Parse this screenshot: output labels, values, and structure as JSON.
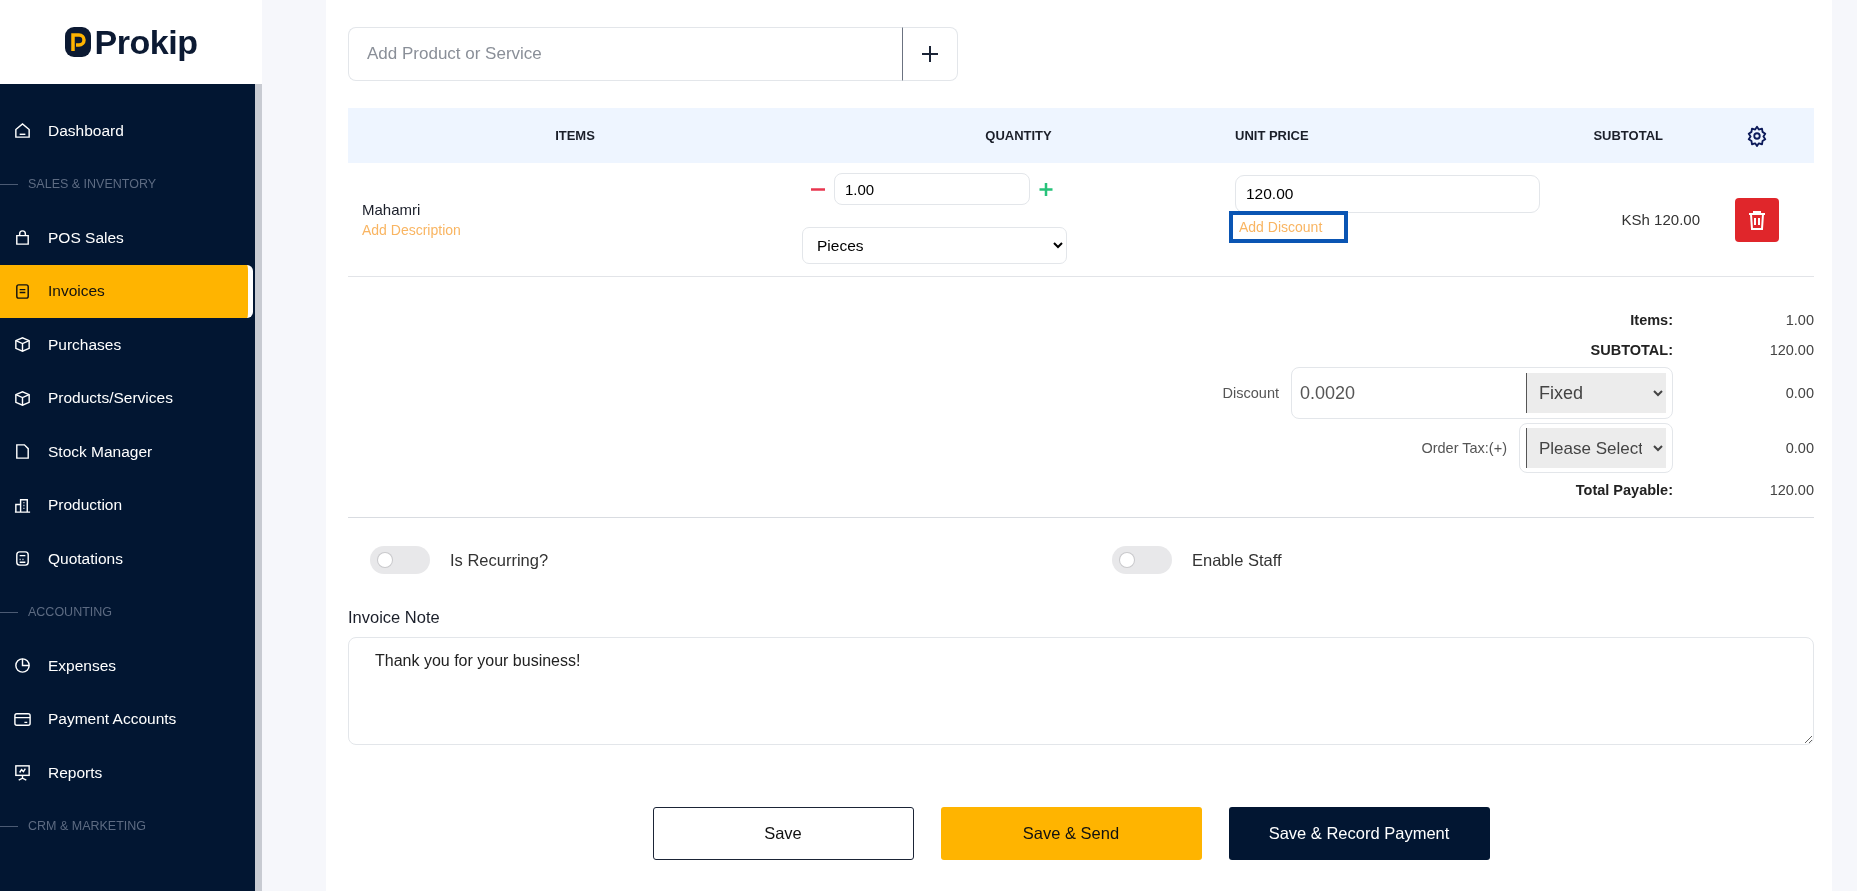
{
  "logo": {
    "text": "Prokip"
  },
  "sidebar": {
    "items": [
      {
        "kind": "link",
        "label": "Dashboard",
        "selected": false
      },
      {
        "kind": "section",
        "label": "SALES & INVENTORY"
      },
      {
        "kind": "link",
        "label": "POS Sales",
        "selected": false
      },
      {
        "kind": "link",
        "label": "Invoices",
        "selected": true
      },
      {
        "kind": "link",
        "label": "Purchases",
        "selected": false
      },
      {
        "kind": "link",
        "label": "Products/Services",
        "selected": false
      },
      {
        "kind": "link",
        "label": "Stock Manager",
        "selected": false
      },
      {
        "kind": "link",
        "label": "Production",
        "selected": false
      },
      {
        "kind": "link",
        "label": "Quotations",
        "selected": false
      },
      {
        "kind": "section",
        "label": "ACCOUNTING"
      },
      {
        "kind": "link",
        "label": "Expenses",
        "selected": false
      },
      {
        "kind": "link",
        "label": "Payment Accounts",
        "selected": false
      },
      {
        "kind": "link",
        "label": "Reports",
        "selected": false
      },
      {
        "kind": "section",
        "label": "CRM & MARKETING"
      }
    ]
  },
  "product_search": {
    "placeholder": "Add Product or Service"
  },
  "table": {
    "columns": [
      "ITEMS",
      "QUANTITY",
      "UNIT PRICE",
      "SUBTOTAL"
    ],
    "rows": [
      {
        "item": "Mahamri",
        "description_link": "Add Description",
        "quantity": "1.00",
        "unit": "Pieces",
        "unit_price": "120.00",
        "discount_link": "Add Discount",
        "discount_link_highlighted": true,
        "subtotal": "KSh 120.00"
      }
    ]
  },
  "totals": [
    {
      "kind": "plain",
      "label": "Items:",
      "value": "1.00"
    },
    {
      "kind": "plain",
      "label": "SUBTOTAL:",
      "value": "120.00"
    },
    {
      "kind": "discount",
      "label": "Discount",
      "amount": "0.0020",
      "type": "Fixed",
      "value": "0.00"
    },
    {
      "kind": "tax",
      "label": "Order Tax:(+)",
      "select": "Please Select",
      "value": "0.00"
    },
    {
      "kind": "plain",
      "label": "Total Payable:",
      "value": "120.00"
    }
  ],
  "toggles": [
    {
      "label": "Is Recurring?",
      "on": false
    },
    {
      "label": "Enable Staff",
      "on": false
    }
  ],
  "note": {
    "label": "Invoice Note",
    "value": "Thank you for your business!"
  },
  "buttons": [
    {
      "label": "Save",
      "kind": "outline"
    },
    {
      "label": "Save & Send",
      "kind": "primary"
    },
    {
      "label": "Save & Record Payment",
      "kind": "dark"
    }
  ]
}
